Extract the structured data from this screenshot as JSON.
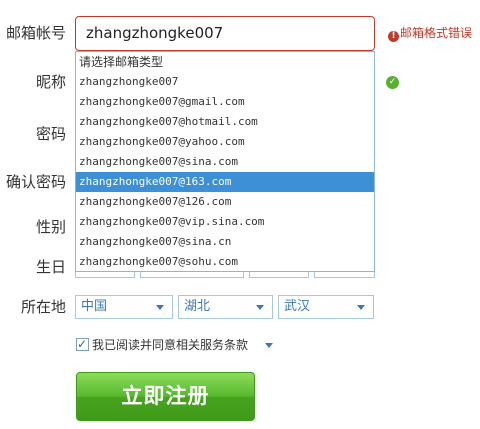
{
  "form": {
    "email_label": "邮箱帐号",
    "email_value": "zhangzhongke007",
    "email_error": "邮箱格式错误",
    "nickname_label": "昵称",
    "password_label": "密码",
    "confirm_password_label": "确认密码",
    "gender_label": "性别",
    "birthday_label": "生日",
    "location_label": "所在地",
    "agree_text": "我已阅读并同意相关服务条款",
    "register_label": "立即注册"
  },
  "email_suggestions": {
    "header": "请选择邮箱类型",
    "items": [
      "zhangzhongke007",
      "zhangzhongke007@gmail.com",
      "zhangzhongke007@hotmail.com",
      "zhangzhongke007@yahoo.com",
      "zhangzhongke007@sina.com",
      "zhangzhongke007@163.com",
      "zhangzhongke007@126.com",
      "zhangzhongke007@vip.sina.com",
      "zhangzhongke007@sina.cn",
      "zhangzhongke007@sohu.com"
    ],
    "selected": "zhangzhongke007@163.com"
  },
  "location": {
    "country": "中国",
    "province": "湖北",
    "city": "武汉"
  },
  "colors": {
    "error": "#c0392b",
    "selected_bg": "#3d8fd6",
    "button_green": "#55b82b"
  }
}
